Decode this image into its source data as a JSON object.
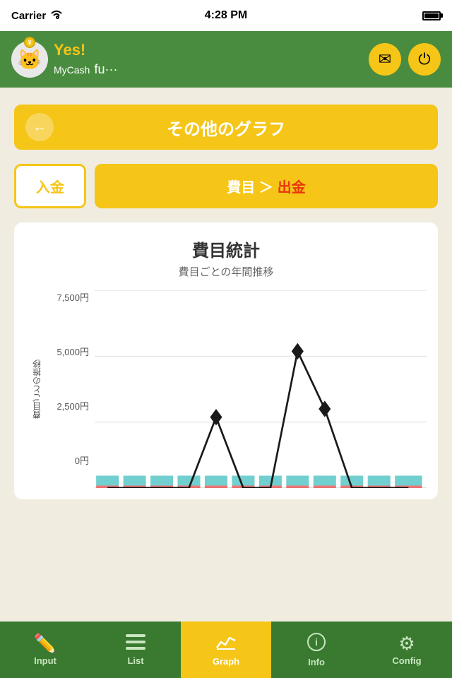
{
  "status": {
    "carrier": "Carrier",
    "time": "4:28 PM",
    "wifi": true
  },
  "header": {
    "app_name": "Yes!\nMyCash",
    "suffix": "fu···",
    "icon_mail": "✉",
    "icon_power": "⏻"
  },
  "section": {
    "back_icon": "←",
    "title": "その他のグラフ"
  },
  "filters": {
    "deposit_label": "入金",
    "expense_label": "費目 ＞",
    "expense_highlight": "出金"
  },
  "chart": {
    "title": "費目統計",
    "subtitle": "費目ごとの年間推移",
    "y_axis_label": "費目ごとの推移",
    "y_labels": [
      "7,500円",
      "5,000円",
      "2,500円",
      "0円"
    ],
    "data_points": [
      0,
      0,
      0,
      0,
      2700,
      0,
      0,
      5200,
      3000,
      0,
      0,
      0
    ]
  },
  "tabs": [
    {
      "id": "input",
      "icon": "✏",
      "label": "Input",
      "active": false
    },
    {
      "id": "list",
      "icon": "☰",
      "label": "List",
      "active": false
    },
    {
      "id": "graph",
      "icon": "📈",
      "label": "Graph",
      "active": true
    },
    {
      "id": "info",
      "icon": "ℹ",
      "label": "Info",
      "active": false
    },
    {
      "id": "config",
      "icon": "⚙",
      "label": "Config",
      "active": false
    }
  ]
}
